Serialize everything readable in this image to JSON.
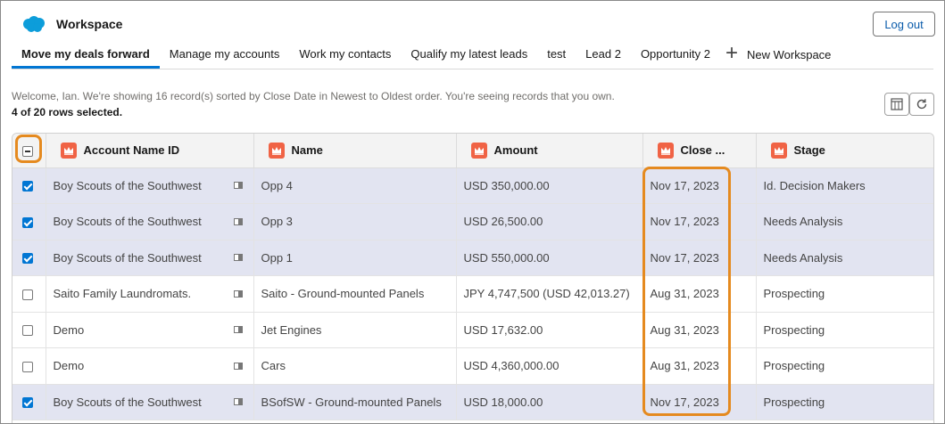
{
  "app": {
    "title": "Workspace",
    "logout_label": "Log out"
  },
  "tabs": [
    {
      "label": "Move my deals forward",
      "active": true
    },
    {
      "label": "Manage my accounts"
    },
    {
      "label": "Work my contacts"
    },
    {
      "label": "Qualify my latest leads"
    },
    {
      "label": "test"
    },
    {
      "label": "Lead 2"
    },
    {
      "label": "Opportunity 2"
    }
  ],
  "new_tab_label": "New Workspace",
  "info": {
    "message": "Welcome, Ian. We're showing 16 record(s) sorted by Close Date in Newest to Oldest order. You're seeing records that you own.",
    "selection": "4 of 20 rows selected."
  },
  "toolbar": {
    "column_settings_icon": "column-settings-icon",
    "refresh_icon": "refresh-icon"
  },
  "table": {
    "columns": [
      "Account Name ID",
      "Name",
      "Amount",
      "Close ...",
      "Stage"
    ],
    "rows": [
      {
        "selected": true,
        "account": "Boy Scouts of the Southwest",
        "name": "Opp 4",
        "amount": "USD 350,000.00",
        "close": "Nov 17, 2023",
        "stage": "Id. Decision Makers"
      },
      {
        "selected": true,
        "account": "Boy Scouts of the Southwest",
        "name": "Opp 3",
        "amount": "USD 26,500.00",
        "close": "Nov 17, 2023",
        "stage": "Needs Analysis"
      },
      {
        "selected": true,
        "account": "Boy Scouts of the Southwest",
        "name": "Opp 1",
        "amount": "USD 550,000.00",
        "close": "Nov 17, 2023",
        "stage": "Needs Analysis"
      },
      {
        "selected": false,
        "account": "Saito Family Laundromats.",
        "name": "Saito - Ground-mounted Panels",
        "amount": "JPY 4,747,500 (USD 42,013.27)",
        "close": "Aug 31, 2023",
        "stage": "Prospecting"
      },
      {
        "selected": false,
        "account": "Demo",
        "name": "Jet Engines",
        "amount": "USD 17,632.00",
        "close": "Aug 31, 2023",
        "stage": "Prospecting"
      },
      {
        "selected": false,
        "account": "Demo",
        "name": "Cars",
        "amount": "USD 4,360,000.00",
        "close": "Aug 31, 2023",
        "stage": "Prospecting"
      },
      {
        "selected": true,
        "account": "Boy Scouts of the Southwest",
        "name": "BSofSW - Ground-mounted Panels",
        "amount": "USD 18,000.00",
        "close": "Nov 17, 2023",
        "stage": "Prospecting"
      }
    ]
  },
  "colors": {
    "accent": "#0176d3",
    "selected_row": "#e2e4f1",
    "highlight": "#e58a1f",
    "column_icon": "#f06345"
  }
}
